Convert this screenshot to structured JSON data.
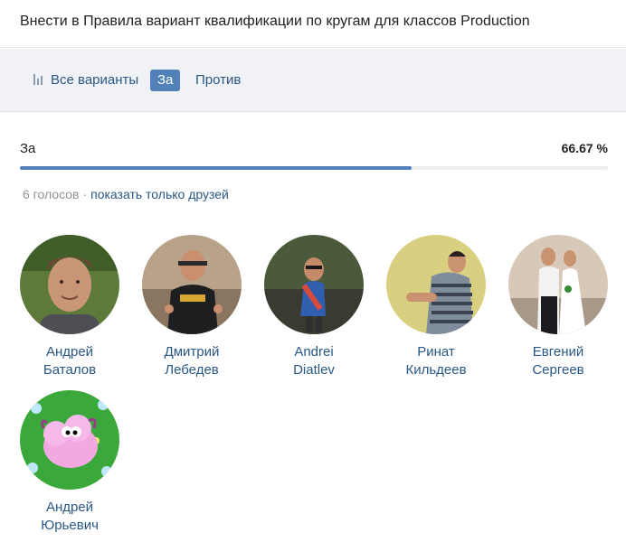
{
  "poll": {
    "title": "Внести в Правила вариант квалификации по кругам для классов Production"
  },
  "tabs": {
    "all_label": "Все варианты",
    "for_label": "За",
    "against_label": "Против"
  },
  "result": {
    "option_label": "За",
    "percent_text": "66.67 %",
    "fraction": 0.6667
  },
  "meta": {
    "votes_count": "6 голосов",
    "separator": "·",
    "friends_only_label": "показать только друзей"
  },
  "voters": [
    {
      "first": "Андрей",
      "last": "Баталов",
      "avatar": "photo-portrait-man"
    },
    {
      "first": "Дмитрий",
      "last": "Лебедев",
      "avatar": "photo-man-black-tshirt"
    },
    {
      "first": "Andrei",
      "last": "Diatlev",
      "avatar": "photo-man-outdoors"
    },
    {
      "first": "Ринат",
      "last": "Кильдеев",
      "avatar": "photo-man-striped-shirt"
    },
    {
      "first": "Евгений",
      "last": "Сергеев",
      "avatar": "photo-wedding-couple"
    },
    {
      "first": "Андрей",
      "last": "Юрьевич",
      "avatar": "cartoon-pink-sheep"
    }
  ],
  "colors": {
    "accent": "#5181b8",
    "link": "#2a5885",
    "muted": "#939393",
    "tabs_bg": "#f0f2f5"
  }
}
